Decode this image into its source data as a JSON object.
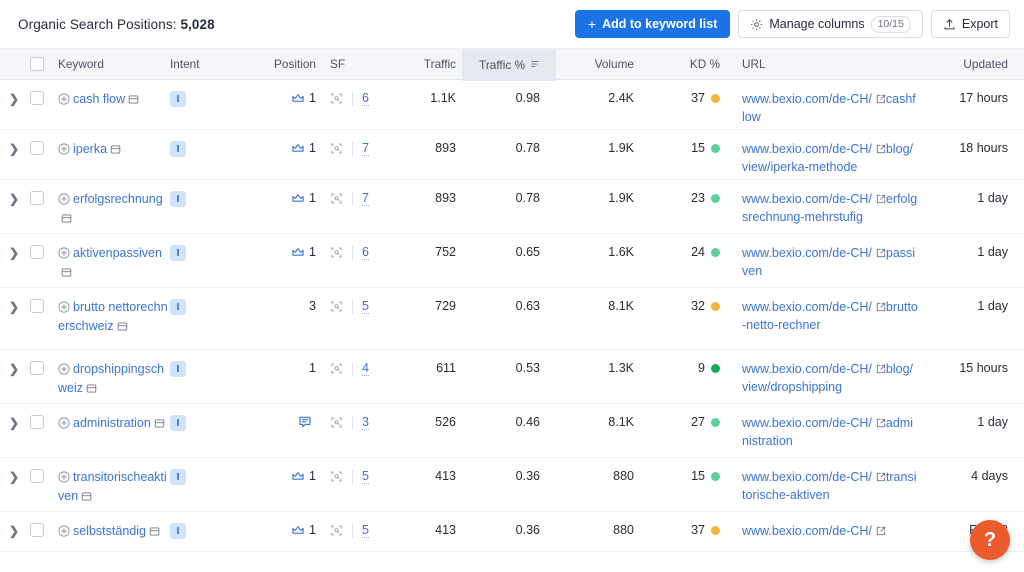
{
  "topbar": {
    "title_prefix": "Organic Search Positions: ",
    "title_count": "5,028",
    "add_to_list_label": "Add to keyword list",
    "manage_columns_label": "Manage columns",
    "manage_columns_count": "10/15",
    "export_label": "Export",
    "primary_color": "#1b74e7"
  },
  "columns": [
    {
      "key": "keyword",
      "label": "Keyword"
    },
    {
      "key": "intent",
      "label": "Intent"
    },
    {
      "key": "position",
      "label": "Position"
    },
    {
      "key": "sf",
      "label": "SF"
    },
    {
      "key": "traffic",
      "label": "Traffic"
    },
    {
      "key": "traffic_pct",
      "label": "Traffic %",
      "sorted": true,
      "sort_dir": "desc"
    },
    {
      "key": "volume",
      "label": "Volume"
    },
    {
      "key": "kd",
      "label": "KD %"
    },
    {
      "key": "url",
      "label": "URL"
    },
    {
      "key": "updated",
      "label": "Updated"
    }
  ],
  "rows": [
    {
      "keyword": "cash flow",
      "intent": "I",
      "position": "1",
      "position_icon": "crown-icon",
      "sf": "6",
      "traffic": "1.1K",
      "traffic_pct": "0.98",
      "volume": "2.4K",
      "kd": "37",
      "kd_color": "#f2b53c",
      "url": "www.bexio.com/de-CH/cashflow",
      "url_lines": [
        "www.bexio.com/de-CH/",
        "cashflow"
      ],
      "updated": "17 hours"
    },
    {
      "keyword": "iperka",
      "intent": "I",
      "position": "1",
      "position_icon": "crown-icon",
      "sf": "7",
      "traffic": "893",
      "traffic_pct": "0.78",
      "volume": "1.9K",
      "kd": "15",
      "kd_color": "#5ad29a",
      "url": "www.bexio.com/de-CH/blog/view/iperka-methode",
      "url_lines": [
        "www.bexio.com/de-CH/",
        "blog/view/iperka-metho",
        "de"
      ],
      "updated": "18 hours"
    },
    {
      "keyword": "erfolgsrechnung",
      "keyword_lines": [
        "erfolgsrechnu",
        "ng"
      ],
      "intent": "I",
      "position": "1",
      "position_icon": "crown-icon",
      "sf": "7",
      "traffic": "893",
      "traffic_pct": "0.78",
      "volume": "1.9K",
      "kd": "23",
      "kd_color": "#5ad29a",
      "url": "www.bexio.com/de-CH/erfolgsrechnung-mehrstufig",
      "url_lines": [
        "www.bexio.com/de-CH/",
        "erfolgsrechnung-mehrs",
        "tufig"
      ],
      "updated": "1 day"
    },
    {
      "keyword": "aktiven passiven",
      "keyword_lines": [
        "aktiven",
        "passiven"
      ],
      "intent": "I",
      "position": "1",
      "position_icon": "crown-icon",
      "sf": "6",
      "traffic": "752",
      "traffic_pct": "0.65",
      "volume": "1.6K",
      "kd": "24",
      "kd_color": "#5ad29a",
      "url": "www.bexio.com/de-CH/passiven",
      "url_lines": [
        "www.bexio.com/de-CH/",
        "passiven"
      ],
      "updated": "1 day"
    },
    {
      "keyword": "brutto netto rechner schweiz",
      "keyword_lines": [
        "brutto netto",
        "rechner",
        "schweiz"
      ],
      "intent": "I",
      "position": "3",
      "position_icon": "none",
      "sf": "5",
      "traffic": "729",
      "traffic_pct": "0.63",
      "volume": "8.1K",
      "kd": "32",
      "kd_color": "#f2b53c",
      "url": "www.bexio.com/de-CH/brutto-netto-rechner",
      "url_lines": [
        "www.bexio.com/de-CH/",
        "brutto-netto-rechner"
      ],
      "updated": "1 day"
    },
    {
      "keyword": "dropshipping schweiz",
      "keyword_lines": [
        "dropshipping",
        "schweiz"
      ],
      "intent": "I",
      "position": "1",
      "position_icon": "none",
      "sf": "4",
      "traffic": "611",
      "traffic_pct": "0.53",
      "volume": "1.3K",
      "kd": "9",
      "kd_color": "#16a765",
      "url": "www.bexio.com/de-CH/blog/view/dropshipping",
      "url_lines": [
        "www.bexio.com/de-CH/",
        "blog/view/dropshipping"
      ],
      "updated": "15 hours"
    },
    {
      "keyword": "administration",
      "keyword_lines": [
        "administratio",
        "n"
      ],
      "intent": "I",
      "position": "",
      "position_icon": "featured-snippet-icon",
      "sf": "3",
      "traffic": "526",
      "traffic_pct": "0.46",
      "volume": "8.1K",
      "kd": "27",
      "kd_color": "#5ad29a",
      "url": "www.bexio.com/de-CH/administration",
      "url_lines": [
        "www.bexio.com/de-CH/",
        "administration"
      ],
      "updated": "1 day"
    },
    {
      "keyword": "transitorische aktiven",
      "keyword_lines": [
        "transitorische",
        "aktiven"
      ],
      "intent": "I",
      "position": "1",
      "position_icon": "crown-icon",
      "sf": "5",
      "traffic": "413",
      "traffic_pct": "0.36",
      "volume": "880",
      "kd": "15",
      "kd_color": "#5ad29a",
      "url": "www.bexio.com/de-CH/transitorische-aktiven",
      "url_lines": [
        "www.bexio.com/de-CH/",
        "transitorische-aktiven"
      ],
      "updated": "4 days"
    },
    {
      "keyword": "selbstständig",
      "keyword_lines": [
        "selbstständig"
      ],
      "intent": "I",
      "position": "1",
      "position_icon": "crown-icon",
      "sf": "5",
      "traffic": "413",
      "traffic_pct": "0.36",
      "volume": "880",
      "kd": "37",
      "kd_color": "#f2b53c",
      "url": "www.bexio.com/de-CH/",
      "url_lines": [
        "www.bexio.com/de-CH/"
      ],
      "updated": "Feb 18"
    }
  ],
  "help": {
    "label": "?",
    "color": "#ec5b2b"
  }
}
